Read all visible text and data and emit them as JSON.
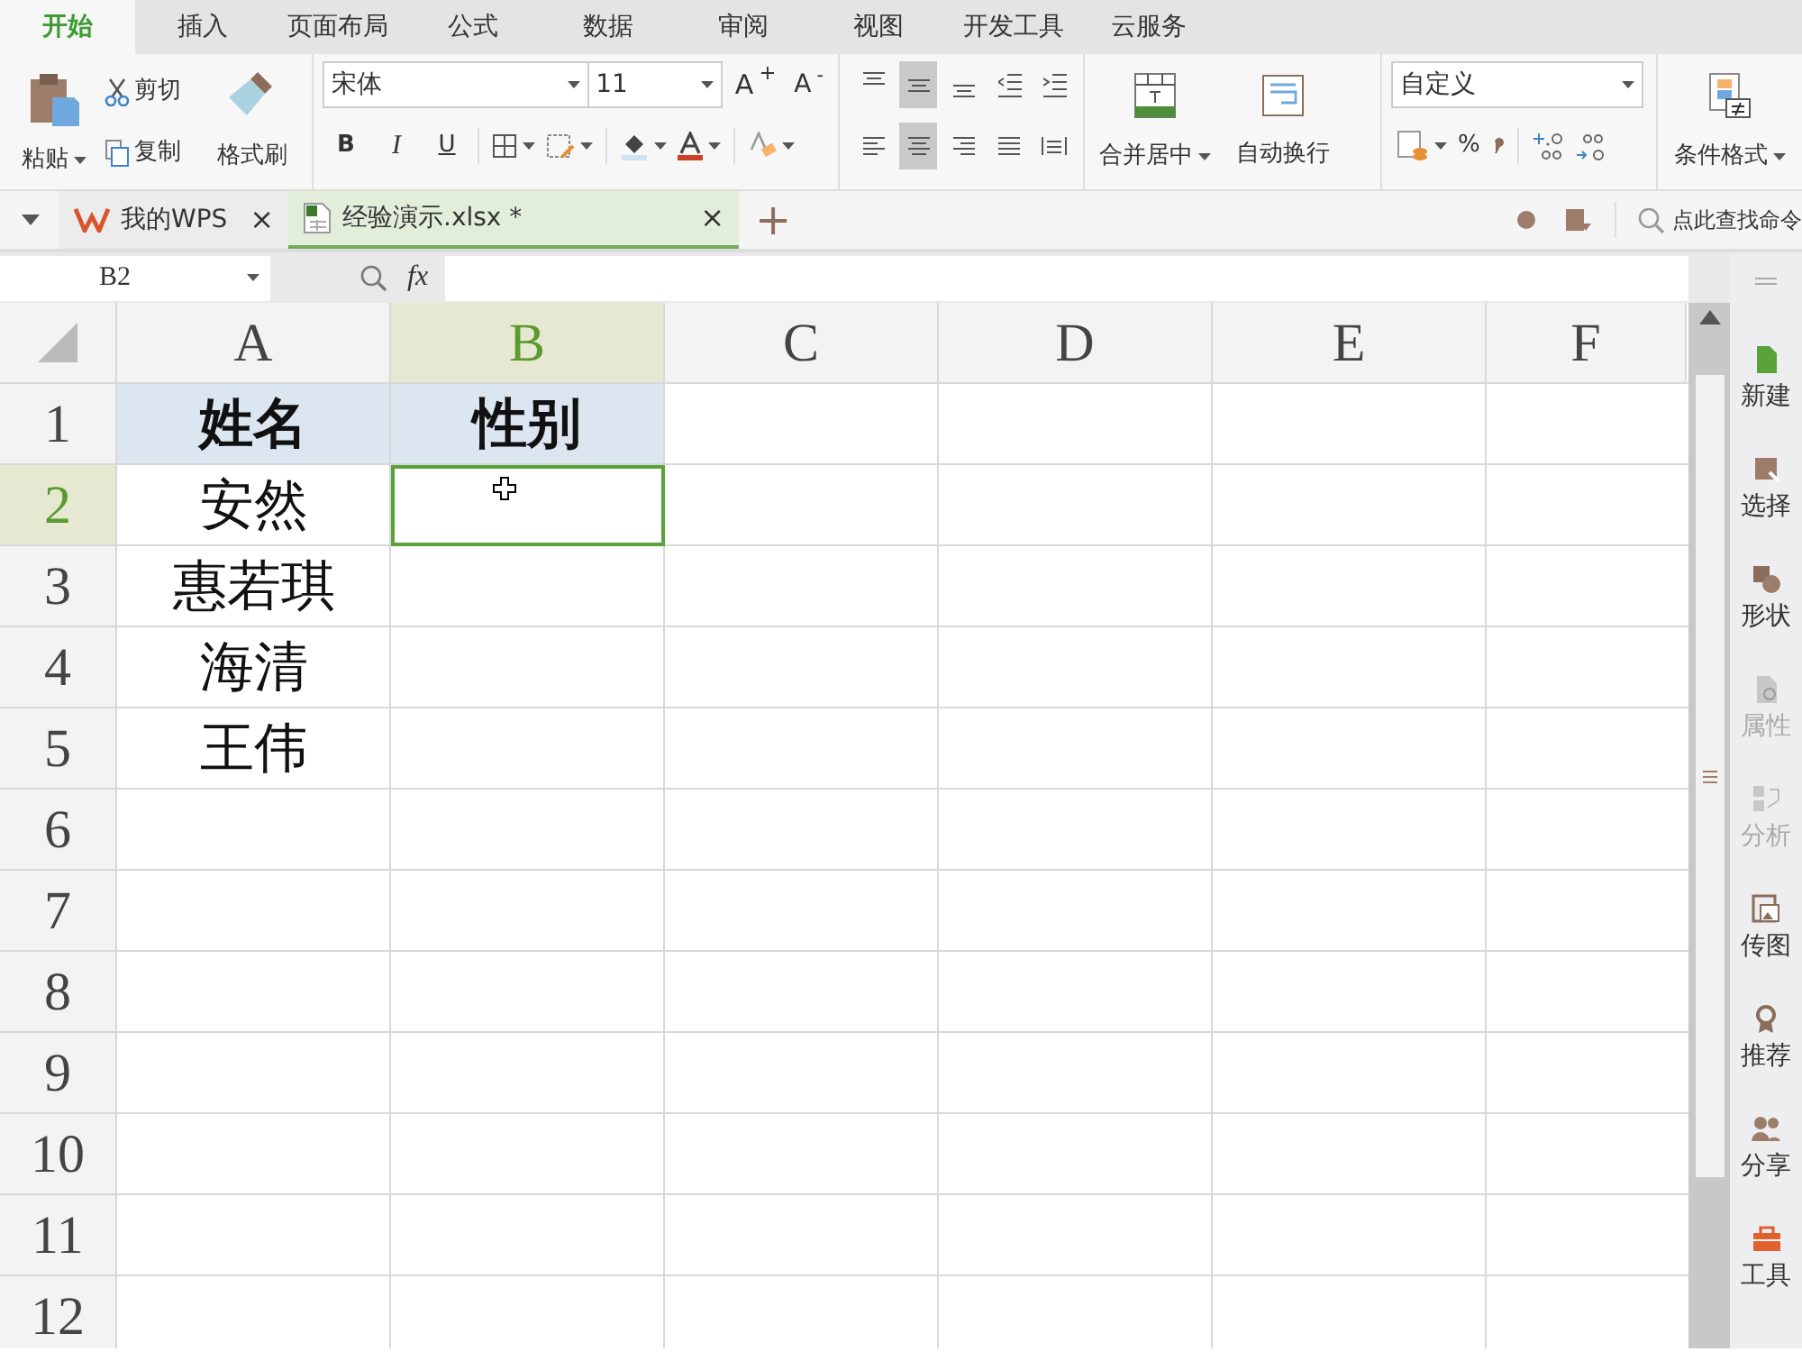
{
  "ribbon_tabs": [
    {
      "label": "开始",
      "selected": true
    },
    {
      "label": "插入",
      "selected": false
    },
    {
      "label": "页面布局",
      "selected": false
    },
    {
      "label": "公式",
      "selected": false
    },
    {
      "label": "数据",
      "selected": false
    },
    {
      "label": "审阅",
      "selected": false
    },
    {
      "label": "视图",
      "selected": false
    },
    {
      "label": "开发工具",
      "selected": false
    },
    {
      "label": "云服务",
      "selected": false
    }
  ],
  "clipboard": {
    "paste": "粘贴",
    "cut": "剪切",
    "copy": "复制",
    "format_painter": "格式刷"
  },
  "font": {
    "name": "宋体",
    "size": "11",
    "grow": "A$^{+}$",
    "shrink": "A$^{-}$",
    "bold": "B",
    "italic": "I",
    "underline": "U"
  },
  "alignment_buttons": [
    {
      "selected": false
    },
    {
      "selected": true
    },
    {
      "selected": false
    },
    {
      "selected": false
    },
    {
      "selected": false
    },
    {
      "selected": false
    },
    {
      "selected": true
    },
    {
      "selected": false
    },
    {
      "selected": false
    },
    {
      "selected": false
    }
  ],
  "merge": "合并居中",
  "wrap": "自动换行",
  "number": {
    "format": "自定义",
    "percent": "%"
  },
  "conditional_format": "条件格式",
  "doc_tabs": [
    {
      "label": "我的WPS",
      "selected": false,
      "close": "×"
    },
    {
      "label": "经验演示.xlsx *",
      "selected": true,
      "close": "×"
    }
  ],
  "new_tab": "+",
  "command_search": {
    "placeholder": "点此查找命令"
  },
  "formula_bar": {
    "name_box": "B2",
    "fx": "fx"
  },
  "sheet": {
    "columns": [
      {
        "label": "A",
        "selected": false
      },
      {
        "label": "B",
        "selected": true
      },
      {
        "label": "C",
        "selected": false
      },
      {
        "label": "D",
        "selected": false
      },
      {
        "label": "E",
        "selected": false
      },
      {
        "label": "F",
        "selected": false
      }
    ],
    "rows": [
      {
        "label": "1",
        "selected": false,
        "kind": "header",
        "cells": [
          "姓名",
          "性别"
        ]
      },
      {
        "label": "2",
        "selected": true,
        "kind": "data",
        "cells": [
          "安然"
        ]
      },
      {
        "label": "3",
        "selected": false,
        "kind": "data",
        "cells": [
          "惠若琪"
        ]
      },
      {
        "label": "4",
        "selected": false,
        "kind": "data",
        "cells": [
          "海清"
        ]
      },
      {
        "label": "5",
        "selected": false,
        "kind": "data",
        "cells": [
          "王伟"
        ]
      },
      {
        "label": "6",
        "selected": false,
        "kind": "data"
      },
      {
        "label": "7",
        "selected": false,
        "kind": "data"
      },
      {
        "label": "8",
        "selected": false,
        "kind": "data"
      },
      {
        "label": "9",
        "selected": false,
        "kind": "data"
      },
      {
        "label": "10",
        "selected": false,
        "kind": "data"
      },
      {
        "label": "11",
        "selected": false,
        "kind": "data"
      },
      {
        "label": "12",
        "selected": false,
        "kind": "data"
      }
    ]
  },
  "sidebar": [
    {
      "label": "新建",
      "disabled": false
    },
    {
      "label": "选择",
      "disabled": false
    },
    {
      "label": "形状",
      "disabled": false
    },
    {
      "label": "属性",
      "disabled": true
    },
    {
      "label": "分析",
      "disabled": true
    },
    {
      "label": "传图",
      "disabled": false
    },
    {
      "label": "推荐",
      "disabled": false
    },
    {
      "label": "分享",
      "disabled": false
    },
    {
      "label": "工具",
      "disabled": false
    }
  ]
}
